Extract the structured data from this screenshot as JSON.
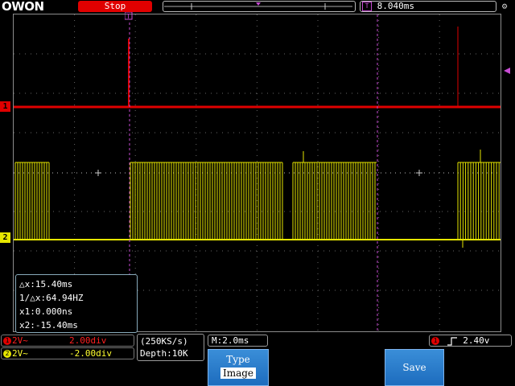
{
  "brand": {
    "logo_text": "OWON"
  },
  "header": {
    "run_state": "Stop",
    "timebase_icon": "T",
    "trigger_position": "8.040ms"
  },
  "channels": {
    "ch1_marker": "1",
    "ch2_marker": "2",
    "ch1_color": "#e00000",
    "ch2_color": "#e6e600"
  },
  "cursor": {
    "dx": "△x:15.40ms",
    "inv_dx": "1/△x:64.94HZ",
    "x1": "x1:0.000ns",
    "x2": "x2:-15.40ms"
  },
  "status": {
    "ch1_num": "1",
    "ch1_coupling": "2V~",
    "ch1_scale": "2.00div",
    "ch2_num": "2",
    "ch2_coupling": "2V~",
    "ch2_scale": "-2.00div",
    "sample_rate": "(250KS/s)",
    "depth": "Depth:10K",
    "timebase": "M:2.0ms",
    "trigger_num": "1",
    "trigger_level": "2.40v"
  },
  "menu": {
    "type_label": "Type",
    "type_value": "Image",
    "save_label": "Save"
  }
}
